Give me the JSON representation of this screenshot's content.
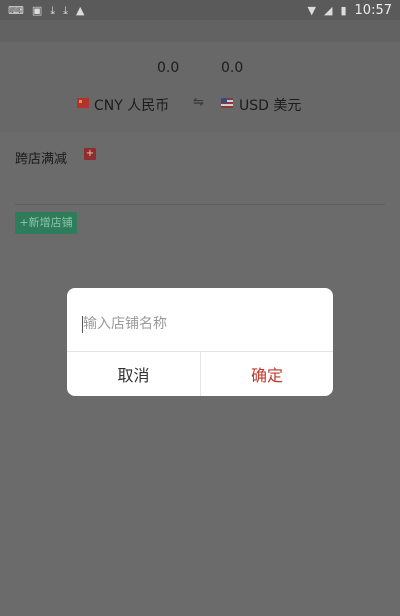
{
  "status_bar": {
    "time": "10:57",
    "left_icons": [
      "keyboard-icon",
      "image-icon",
      "download-icon",
      "download-icon",
      "app-icon"
    ],
    "right_icons": [
      "wifi-icon",
      "signal-icon",
      "battery-icon"
    ]
  },
  "converter": {
    "from_amount": "0.0",
    "to_amount": "0.0",
    "from_currency": "CNY  人民币",
    "swap_symbol": "⇋",
    "to_currency": "USD  美元"
  },
  "content": {
    "cross_store_label": "跨店满减",
    "add_discount_symbol": "+",
    "add_store_label": "+新增店铺"
  },
  "dialog": {
    "input_placeholder": "输入店铺名称",
    "input_value": "",
    "cancel_label": "取消",
    "confirm_label": "确定"
  },
  "colors": {
    "overlay": "#6b6b6b",
    "accent_green": "#2e7c5c",
    "confirm_red": "#c0392b"
  }
}
